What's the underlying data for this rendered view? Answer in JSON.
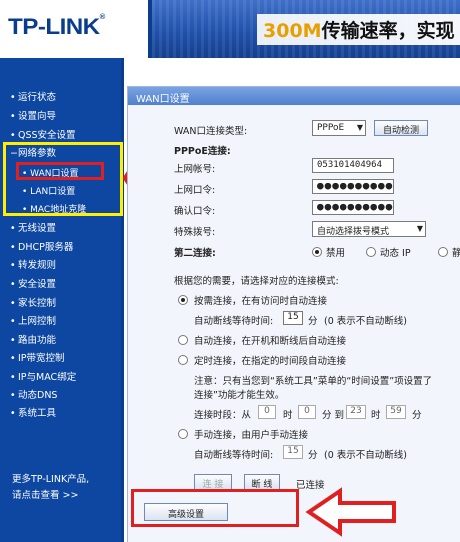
{
  "header": {
    "logo": "TP-LINK",
    "logo_reg": "®",
    "banner_highlight": "300M",
    "banner_text": "传输速率，实现"
  },
  "sidebar": {
    "items": [
      {
        "label": "运行状态"
      },
      {
        "label": "设置向导"
      },
      {
        "label": "QSS安全设置"
      },
      {
        "label": "网络参数",
        "expanded": true
      },
      {
        "label": "无线设置"
      },
      {
        "label": "DHCP服务器"
      },
      {
        "label": "转发规则"
      },
      {
        "label": "安全设置"
      },
      {
        "label": "家长控制"
      },
      {
        "label": "上网控制"
      },
      {
        "label": "路由功能"
      },
      {
        "label": "IP带宽控制"
      },
      {
        "label": "IP与MAC绑定"
      },
      {
        "label": "动态DNS"
      },
      {
        "label": "系统工具"
      }
    ],
    "sub_items": [
      {
        "label": "WAN口设置",
        "active": true
      },
      {
        "label": "LAN口设置"
      },
      {
        "label": "MAC地址克隆"
      }
    ],
    "more_line1": "更多TP-LINK产品,",
    "more_line2": "请点击查看 >>"
  },
  "panel": {
    "title": "WAN口设置",
    "wan_type_label": "WAN口连接类型:",
    "wan_type_value": "PPPoE",
    "auto_detect_button": "自动检测",
    "pppoe_heading": "PPPoE连接:",
    "account_label": "上网帐号:",
    "account_value": "053101404964",
    "password_label": "上网口令:",
    "password_value": "●●●●●●●●●●●●",
    "confirm_label": "确认口令:",
    "confirm_value": "●●●●●●●●●●●●",
    "dial_label": "特殊拨号:",
    "dial_value": "自动选择拨号模式",
    "second_conn_label": "第二连接:",
    "second_conn_options": [
      "禁用",
      "动态 IP",
      "静"
    ],
    "mode_prompt": "根据您的需要，请选择对应的连接模式:",
    "mode_on_demand": "按需连接，在有访问时自动连接",
    "idle_label": "自动断线等待时间:",
    "idle_value": "15",
    "idle_unit": "分",
    "idle_note": "(0 表示不自动断线)",
    "mode_auto": "自动连接，在开机和断线后自动连接",
    "mode_timed": "定时连接，在指定的时间段自动连接",
    "timed_note_line1": "注意：只有当您到“系统工具”菜单的“时间设置”项设置了",
    "timed_note_line2": "连接”功能才能生效。",
    "period_label": "连接时段：从",
    "period_from_h": "0",
    "period_h_unit": "时",
    "period_from_m": "0",
    "period_to_label": "分 到",
    "period_to_h": "23",
    "period_to_m": "59",
    "period_m_unit": "分",
    "mode_manual": "手动连接，由用户手动连接",
    "manual_idle_value": "15",
    "connect_button": "连 接",
    "disconnect_button": "断 线",
    "status_text": "已连接",
    "advanced_button": "高级设置"
  },
  "colors": {
    "brand_blue": "#0d47a1",
    "highlight_red": "#e02020",
    "highlight_yellow": "#ffef00"
  }
}
